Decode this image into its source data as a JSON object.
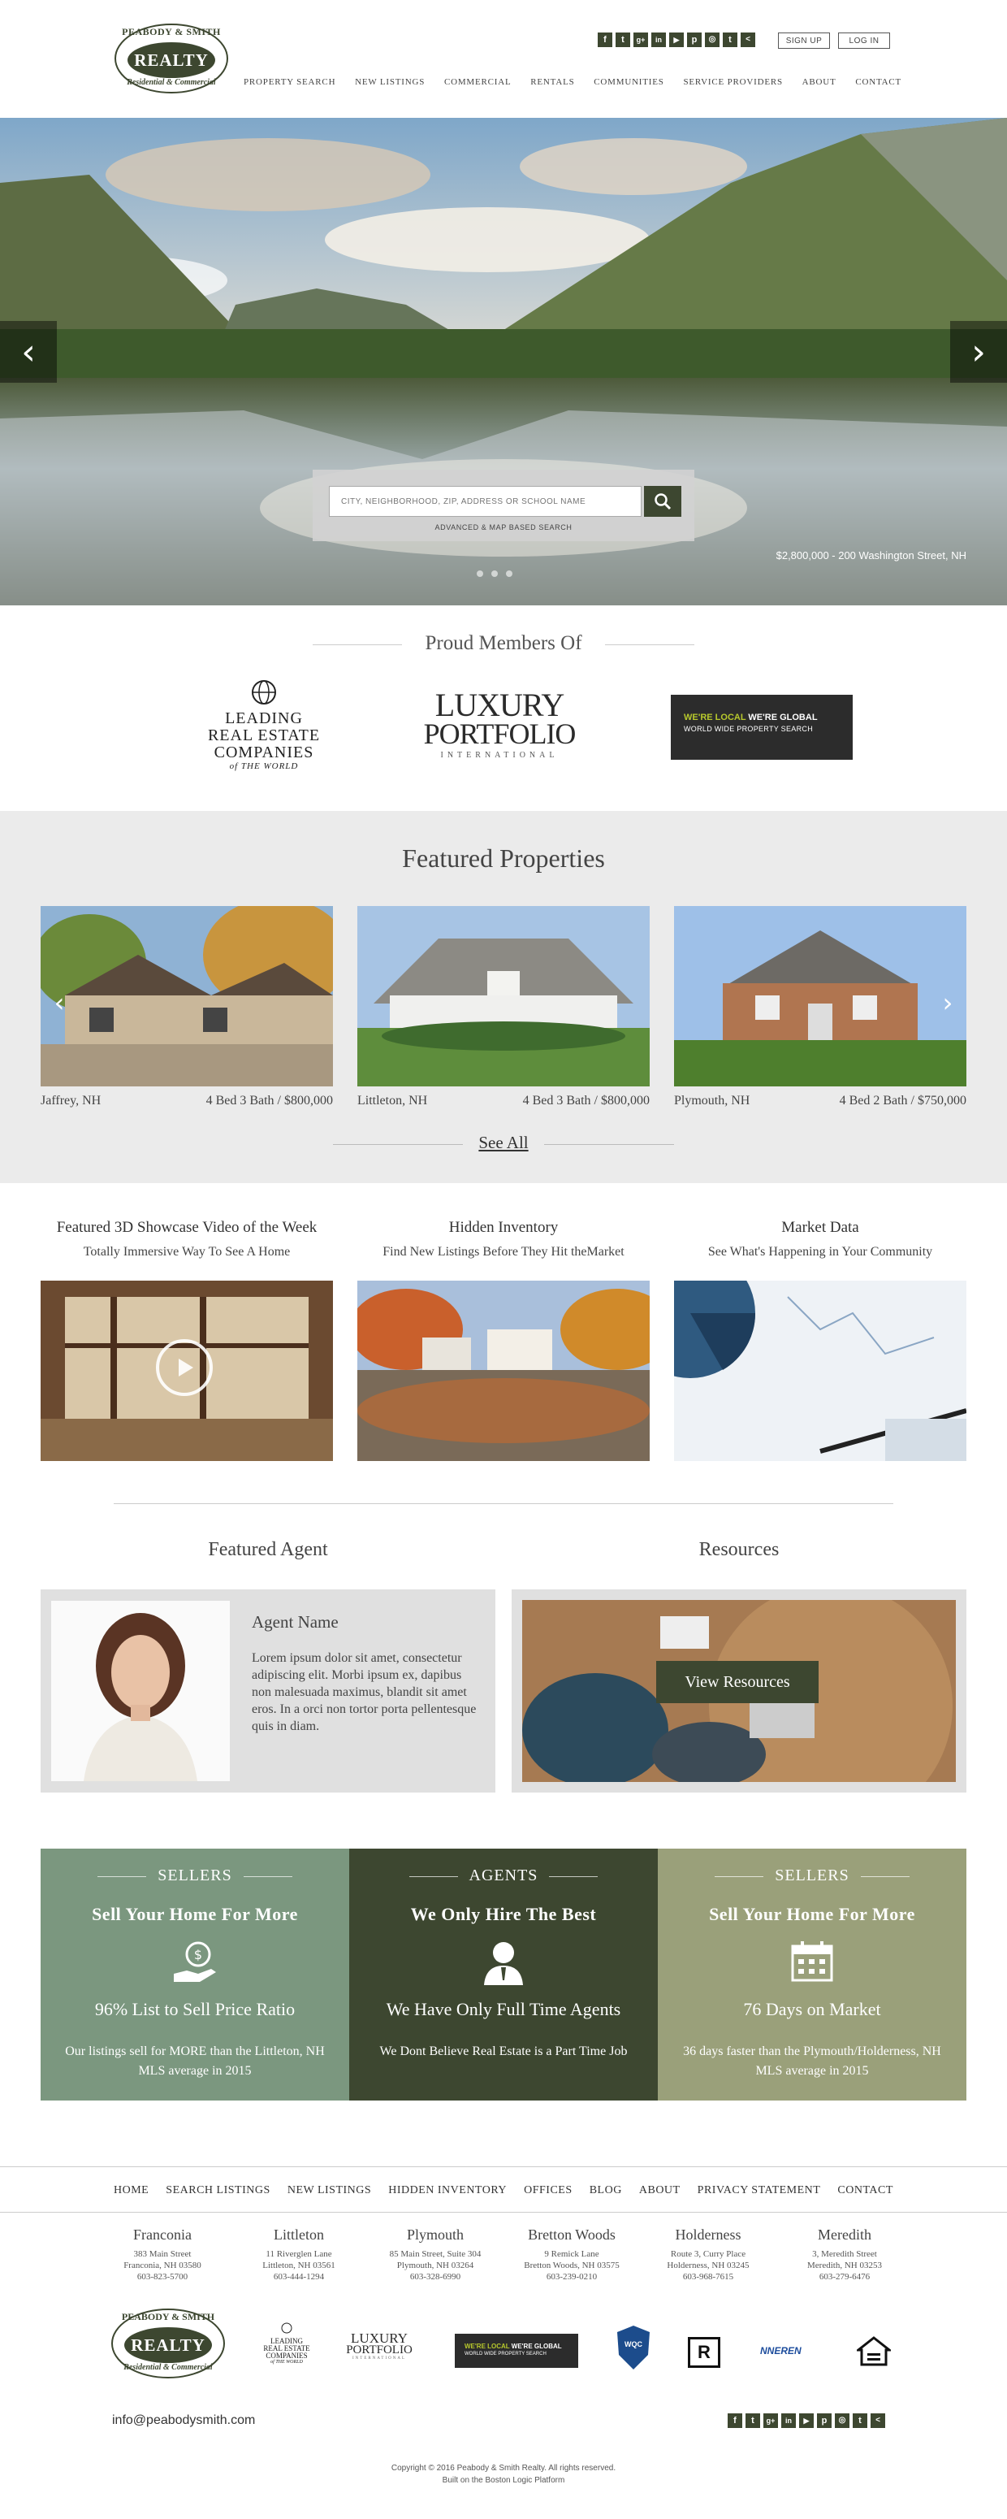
{
  "brand": {
    "line1": "PEABODY & SMITH",
    "line2": "REALTY",
    "line3": "Residential & Commercial",
    "olive": "#3d4730"
  },
  "header": {
    "social_icons": [
      "facebook-icon",
      "twitter-icon",
      "google-plus-icon",
      "linkedin-icon",
      "youtube-icon",
      "pinterest-icon",
      "instagram-icon",
      "tumblr-icon",
      "share-icon"
    ],
    "signup_label": "SIGN UP",
    "login_label": "LOG IN",
    "nav": [
      "PROPERTY SEARCH",
      "NEW LISTINGS",
      "COMMERCIAL",
      "RENTALS",
      "COMMUNITIES",
      "SERVICE PROVIDERS",
      "ABOUT",
      "CONTACT"
    ]
  },
  "hero": {
    "search_placeholder": "CITY, NEIGHBORHOOD, ZIP, ADDRESS OR SCHOOL NAME",
    "advanced_search_label": "ADVANCED & MAP BASED SEARCH",
    "caption": "$2,800,000 - 200 Washington Street, NH",
    "slide_count": 3,
    "active_slide": 1
  },
  "members": {
    "title": "Proud Members Of",
    "lre": {
      "l1": "LEADING",
      "l2": "REAL ESTATE",
      "l3": "COMPANIES",
      "l4": "of THE WORLD"
    },
    "luxury": {
      "l1": "LUXURY",
      "l2": "PORTFOLIO",
      "l3": "INTERNATIONAL"
    },
    "local": {
      "l1": "WE'RE LOCAL",
      "l2": "WE'RE GLOBAL",
      "l3": "WORLD WIDE PROPERTY SEARCH"
    }
  },
  "featured": {
    "title": "Featured Properties",
    "properties": [
      {
        "city": "Jaffrey, NH",
        "info": "4 Bed 3 Bath / $800,000"
      },
      {
        "city": "Littleton, NH",
        "info": "4 Bed 3 Bath / $800,000"
      },
      {
        "city": "Plymouth, NH",
        "info": "4 Bed 2 Bath / $750,000"
      }
    ],
    "see_all": "See All"
  },
  "promos": [
    {
      "title": "Featured 3D Showcase Video of the Week",
      "sub": "Totally Immersive Way To See A Home"
    },
    {
      "title": "Hidden Inventory",
      "sub": "Find New Listings Before They Hit theMarket"
    },
    {
      "title": "Market Data",
      "sub": "See What's Happening in Your Community"
    }
  ],
  "agent": {
    "section_title": "Featured Agent",
    "name": "Agent Name",
    "bio": "Lorem ipsum dolor sit amet, consectetur adipiscing elit. Morbi ipsum ex, dapibus non malesuada maximus, blandit sit amet eros. In a orci non tortor porta pellentesque quis in diam."
  },
  "resources": {
    "section_title": "Resources",
    "button": "View Resources"
  },
  "stats": [
    {
      "label": "SELLERS",
      "heading": "Sell Your Home For More",
      "big": "96% List to Sell Price Ratio",
      "small": "Our listings sell for MORE than the Littleton, NH MLS average in 2015",
      "color": "#7b977f"
    },
    {
      "label": "AGENTS",
      "heading": "We Only Hire The Best",
      "big": "We Have Only Full Time Agents",
      "small": "We Dont Believe Real Estate is a Part Time Job",
      "color": "#3d4730"
    },
    {
      "label": "SELLERS",
      "heading": "Sell Your Home For More",
      "big": "76 Days on Market",
      "small": "36 days faster than the Plymouth/Holderness, NH MLS average in 2015",
      "color": "#9aa07a"
    }
  ],
  "footer": {
    "nav": [
      "HOME",
      "SEARCH LISTINGS",
      "NEW LISTINGS",
      "HIDDEN INVENTORY",
      "OFFICES",
      "BLOG",
      "ABOUT",
      "PRIVACY STATEMENT",
      "CONTACT"
    ],
    "offices": [
      {
        "name": "Franconia",
        "street": "383 Main Street",
        "city": "Franconia, NH 03580",
        "phone": "603-823-5700"
      },
      {
        "name": "Littleton",
        "street": "11 Riverglen Lane",
        "city": "Littleton, NH 03561",
        "phone": "603-444-1294"
      },
      {
        "name": "Plymouth",
        "street": "85 Main Street, Suite 304",
        "city": "Plymouth, NH 03264",
        "phone": "603-328-6990"
      },
      {
        "name": "Bretton Woods",
        "street": "9 Remick Lane",
        "city": "Bretton Woods, NH 03575",
        "phone": "603-239-0210"
      },
      {
        "name": "Holderness",
        "street": "Route 3, Curry Place",
        "city": "Holderness, NH 03245",
        "phone": "603-968-7615"
      },
      {
        "name": "Meredith",
        "street": "3, Meredith Street",
        "city": "Meredith, NH 03253",
        "phone": "603-279-6476"
      }
    ],
    "badges": {
      "wqc": "WQC",
      "realtor": "R",
      "nneren": "NNEREN"
    },
    "email": "info@peabodysmith.com",
    "copyright": "Copyright © 2016 Peabody & Smith Realty. All rights reserved.",
    "built_on": "Built on the Boston Logic Platform"
  }
}
